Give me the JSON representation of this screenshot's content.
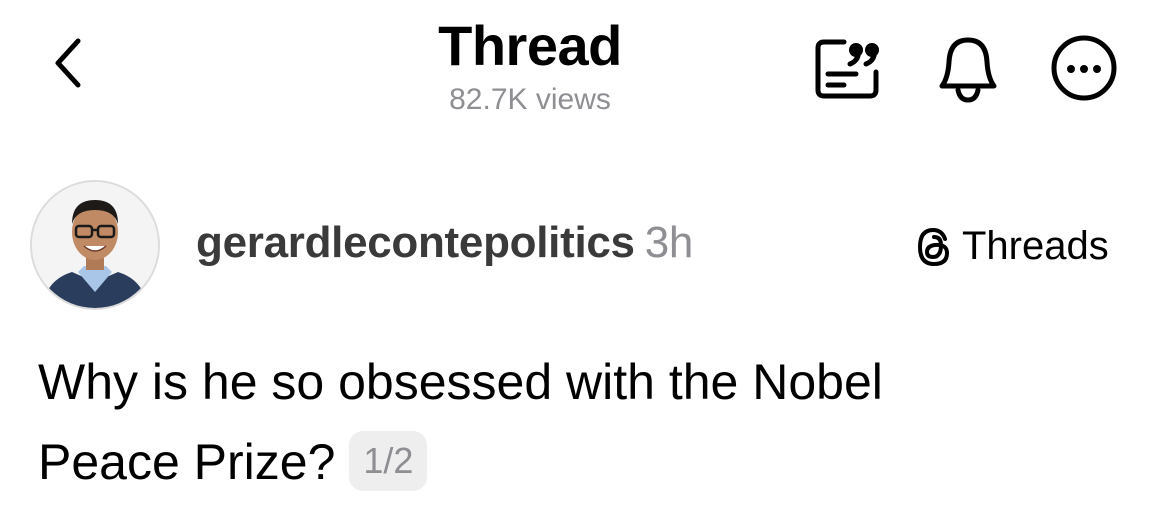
{
  "header": {
    "title": "Thread",
    "views": "82.7K views",
    "icons": {
      "back": "chevron-left-icon",
      "quote": "quote-post-icon",
      "notifications": "bell-icon",
      "more": "more-options-icon"
    }
  },
  "post": {
    "author": {
      "username": "gerardlecontepolitics",
      "timestamp": "3h",
      "avatar": "profile-photo"
    },
    "source_label": "Threads",
    "text_line1": "Why is he so obsessed with the Nobel",
    "text_line2": "Peace Prize?",
    "thread_counter": "1/2"
  },
  "colors": {
    "primary_text": "#000000",
    "secondary_text": "#8e8e93",
    "username_text": "#3a3a3a",
    "badge_bg": "#eeeeee"
  }
}
